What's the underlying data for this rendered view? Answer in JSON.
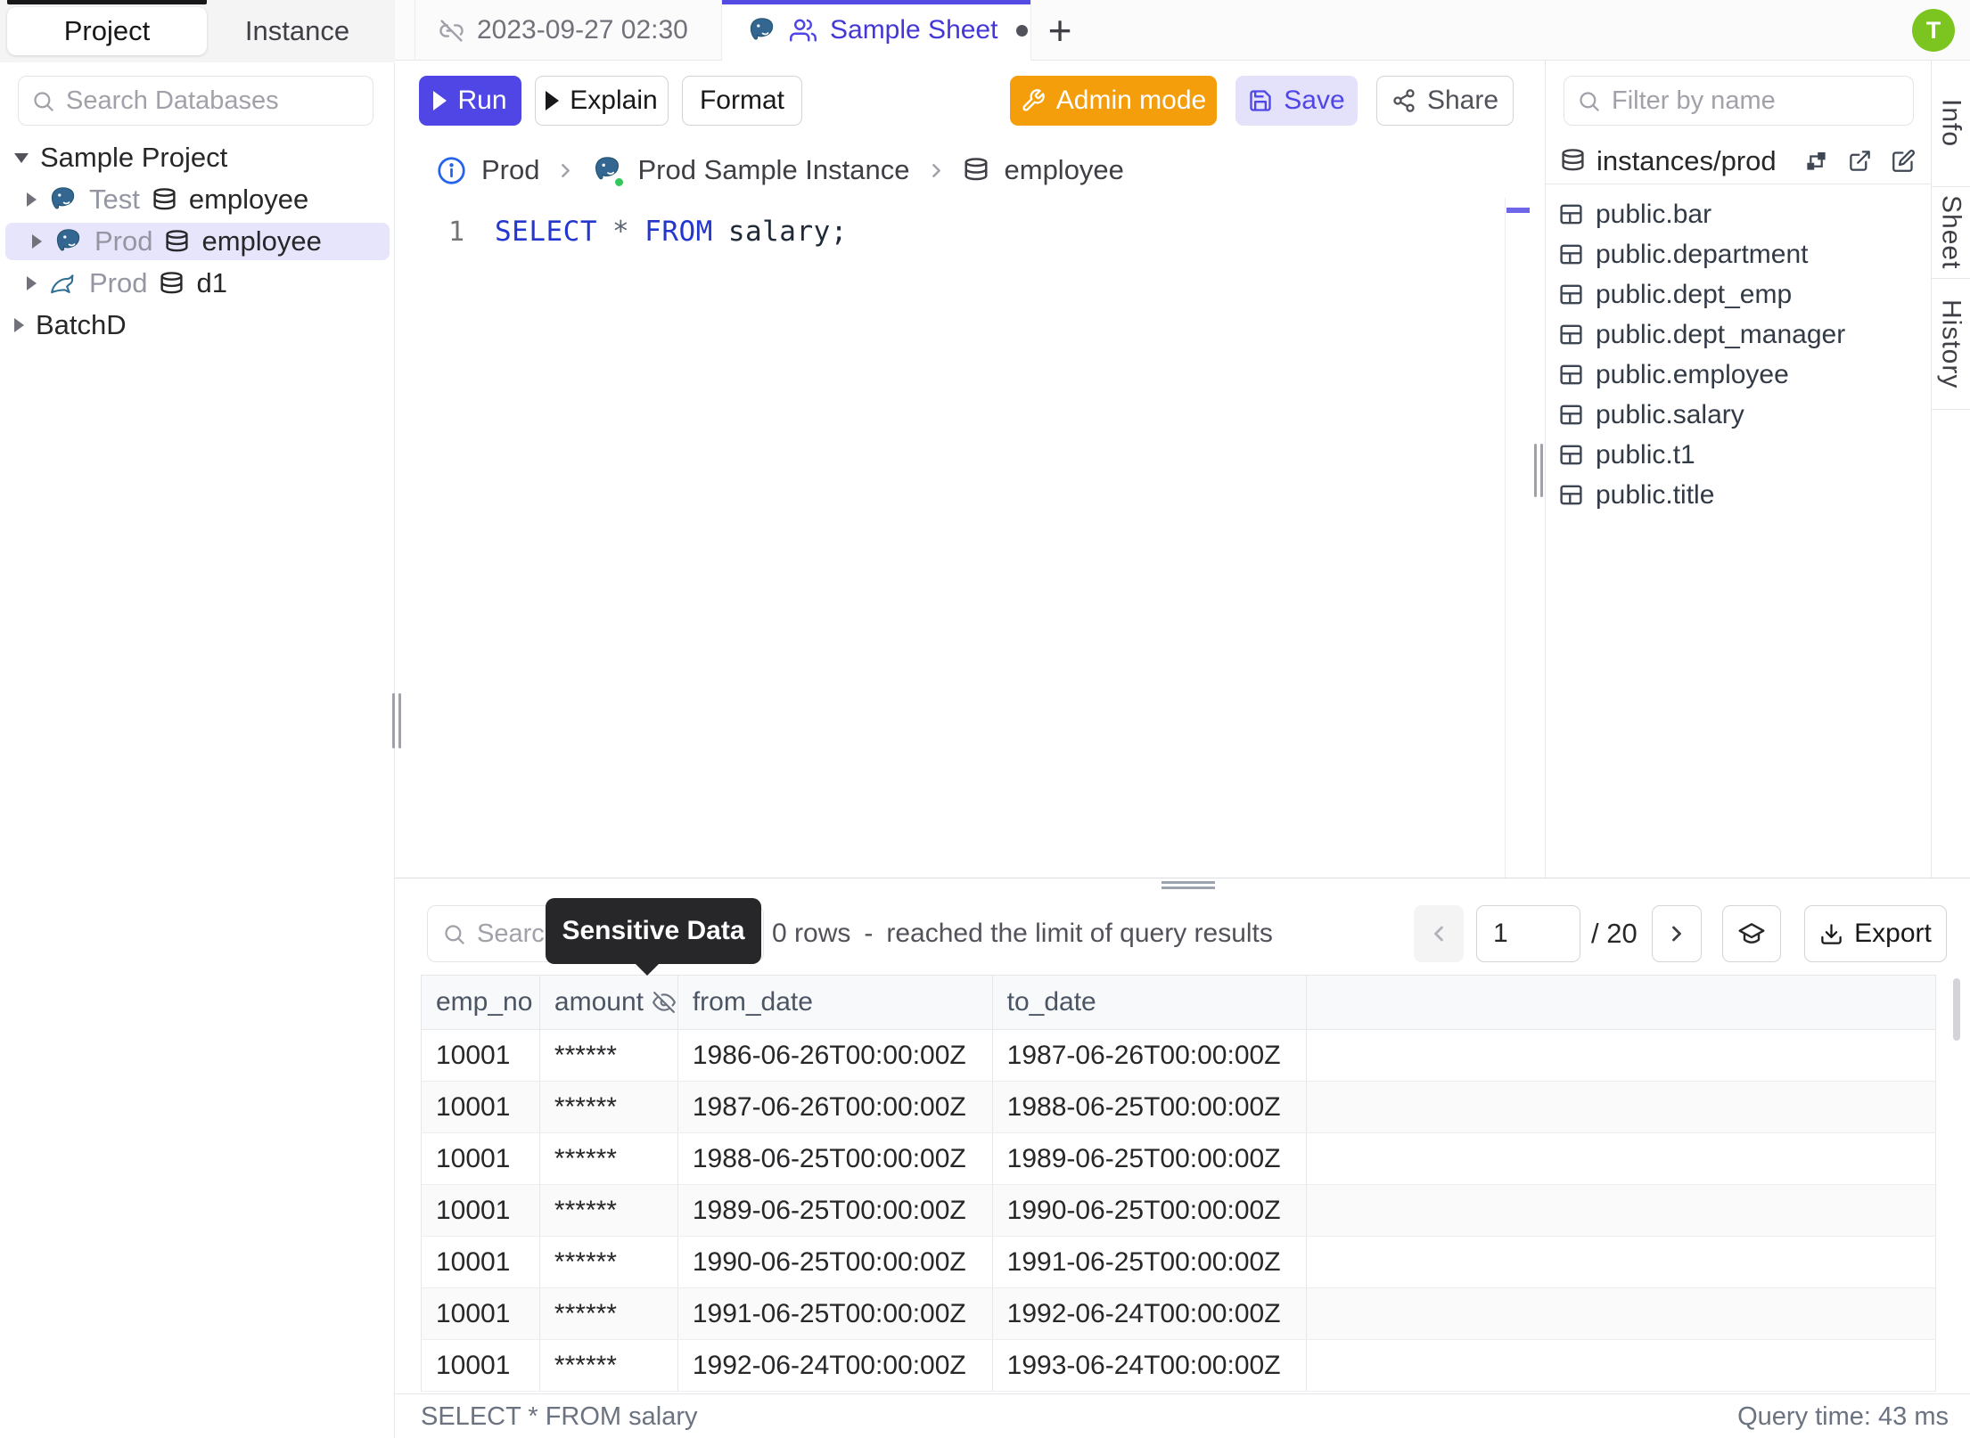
{
  "sidebar": {
    "tabs": [
      {
        "label": "Project"
      },
      {
        "label": "Instance"
      }
    ],
    "search_placeholder": "Search Databases",
    "tree": [
      {
        "label": "Sample Project"
      },
      {
        "env": "Test",
        "db": "employee",
        "engine": "postgres"
      },
      {
        "env": "Prod",
        "db": "employee",
        "engine": "postgres"
      },
      {
        "env": "Prod",
        "db": "d1",
        "engine": "mysql"
      },
      {
        "label": "BatchD"
      }
    ]
  },
  "tab_bar": {
    "sheet_tabs": [
      {
        "title": "2023-09-27 02:30"
      },
      {
        "title": "Sample Sheet"
      }
    ],
    "add_label": "+",
    "avatar": "T"
  },
  "toolbar": {
    "run": "Run",
    "explain": "Explain",
    "format": "Format",
    "admin_mode": "Admin mode",
    "save": "Save",
    "share": "Share"
  },
  "breadcrumb": {
    "environment": "Prod",
    "instance": "Prod Sample Instance",
    "database": "employee"
  },
  "editor": {
    "line_number": "1",
    "sql": {
      "kw1": "SELECT",
      "star": "*",
      "kw2": "FROM",
      "ident": "salary;"
    }
  },
  "schema_panel": {
    "filter_placeholder": "Filter by name",
    "root": "instances/prod",
    "tables": [
      "public.bar",
      "public.department",
      "public.dept_emp",
      "public.dept_manager",
      "public.employee",
      "public.salary",
      "public.t1",
      "public.title"
    ]
  },
  "side_tabs": [
    "Info",
    "Sheet",
    "History"
  ],
  "results": {
    "search_placeholder": "Search",
    "tooltip": "Sensitive Data",
    "rows_count": "0 rows",
    "separator": "-",
    "limit_notice": "reached the limit of query results",
    "page": "1",
    "page_total": "/ 20",
    "export_label": "Export",
    "columns": [
      "emp_no",
      "amount",
      "from_date",
      "to_date"
    ],
    "rows": [
      [
        "10001",
        "******",
        "1986-06-26T00:00:00Z",
        "1987-06-26T00:00:00Z"
      ],
      [
        "10001",
        "******",
        "1987-06-26T00:00:00Z",
        "1988-06-25T00:00:00Z"
      ],
      [
        "10001",
        "******",
        "1988-06-25T00:00:00Z",
        "1989-06-25T00:00:00Z"
      ],
      [
        "10001",
        "******",
        "1989-06-25T00:00:00Z",
        "1990-06-25T00:00:00Z"
      ],
      [
        "10001",
        "******",
        "1990-06-25T00:00:00Z",
        "1991-06-25T00:00:00Z"
      ],
      [
        "10001",
        "******",
        "1991-06-25T00:00:00Z",
        "1992-06-24T00:00:00Z"
      ],
      [
        "10001",
        "******",
        "1992-06-24T00:00:00Z",
        "1993-06-24T00:00:00Z"
      ]
    ],
    "statement": "SELECT * FROM salary",
    "query_time": "Query time: 43 ms"
  },
  "colors": {
    "accent": "#4f46e5",
    "admin_orange": "#f59e0b",
    "avatar_green": "#7cc520",
    "tooltip_bg": "#27272a",
    "selected_tree_row": "#e7e5fc",
    "keyword_blue": "#2337cf",
    "postgres_blue": "#336791"
  }
}
